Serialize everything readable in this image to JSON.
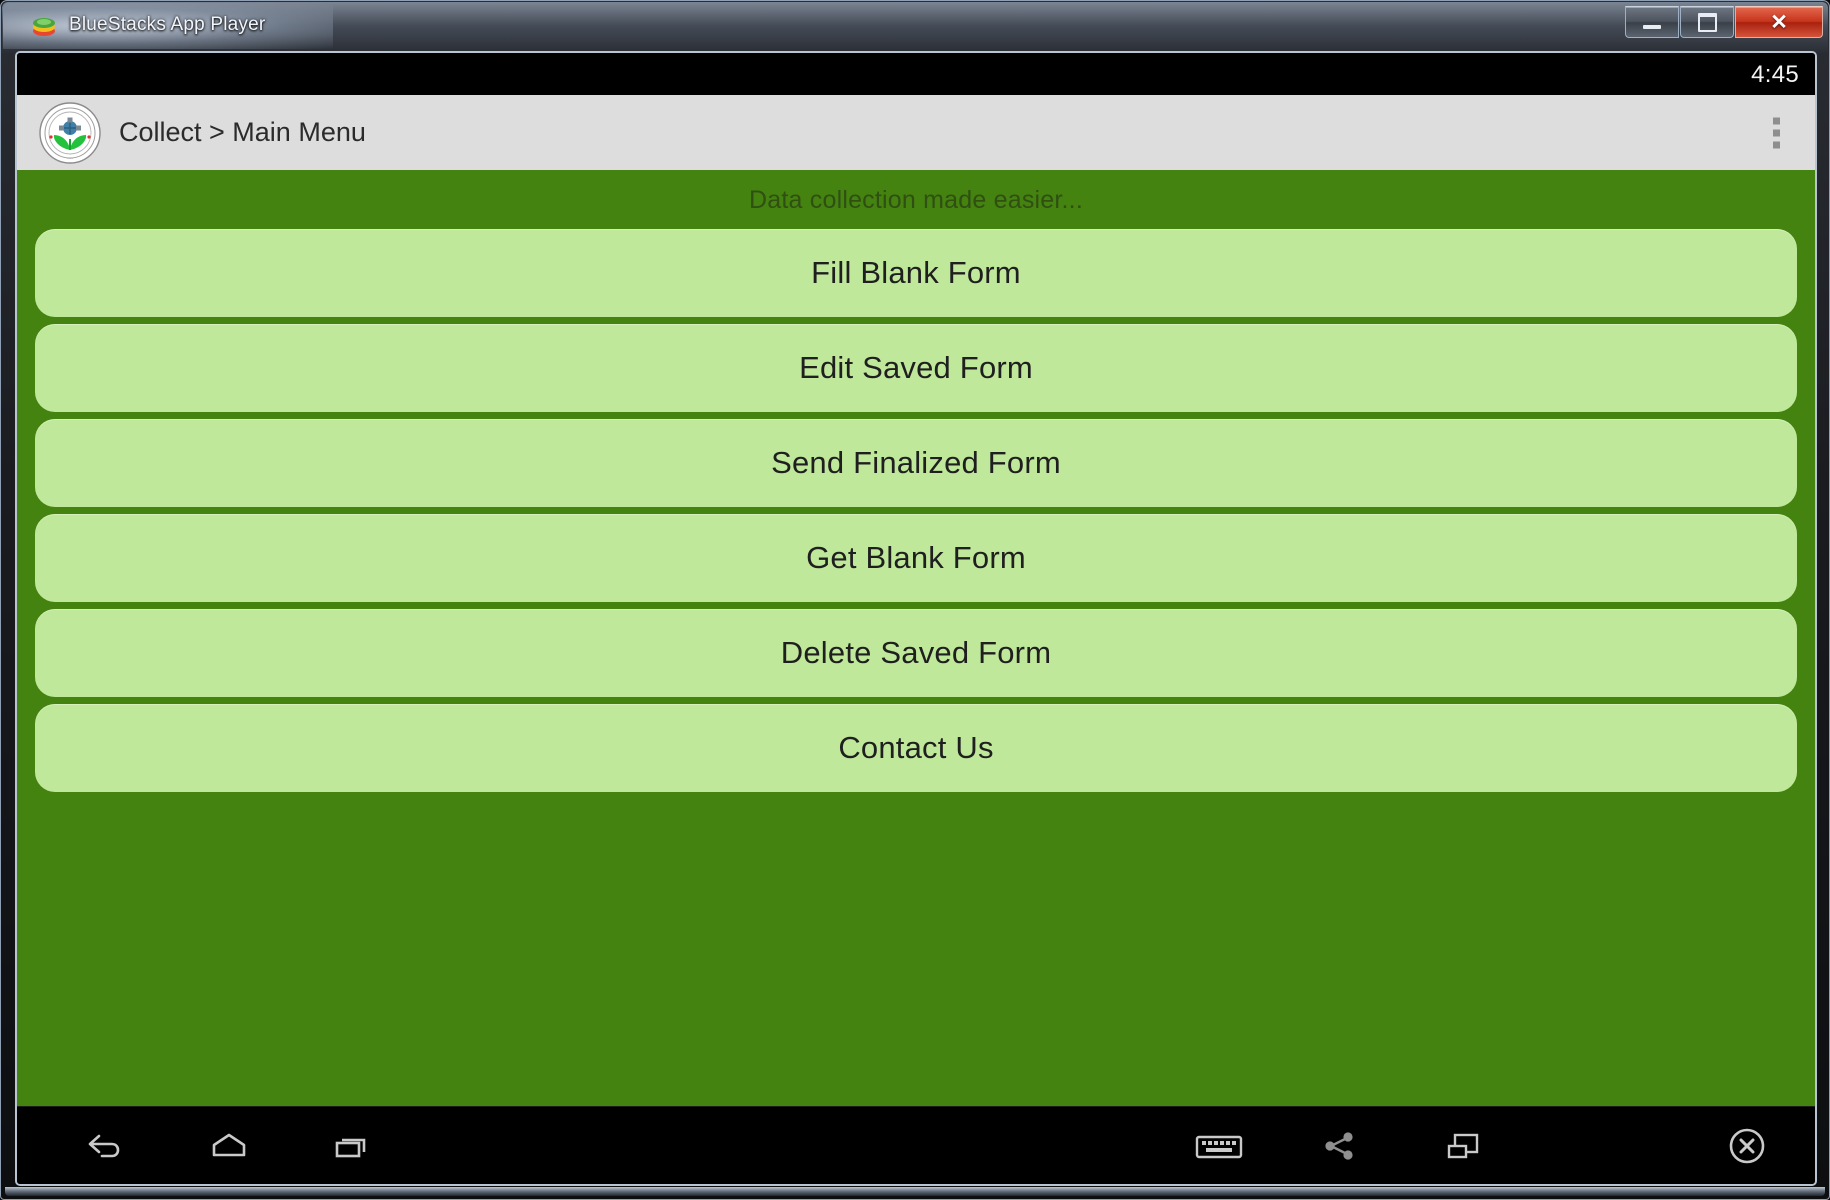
{
  "window": {
    "title": "BlueStacks App Player",
    "app_icon": "bluestacks-stack-icon",
    "controls": {
      "minimize": "minimize-icon",
      "maximize": "maximize-icon",
      "close": "✕"
    }
  },
  "status_bar": {
    "clock": "4:45"
  },
  "action_bar": {
    "logo": "collect-emblem-logo",
    "title": "Collect > Main Menu",
    "overflow": "overflow-menu-icon"
  },
  "content": {
    "tagline": "Data collection made easier...",
    "background_color": "#44830f",
    "button_color": "#bfe89a",
    "buttons": [
      {
        "label": "Fill Blank Form"
      },
      {
        "label": "Edit Saved Form"
      },
      {
        "label": "Send Finalized Form"
      },
      {
        "label": "Get Blank Form"
      },
      {
        "label": "Delete Saved Form"
      },
      {
        "label": "Contact Us"
      }
    ]
  },
  "nav_bar": {
    "back": "back-arrow-icon",
    "home": "home-icon",
    "recents": "recent-apps-icon",
    "keyboard": "keyboard-icon",
    "share": "share-icon",
    "window": "window-resize-icon",
    "close": "close-circle-icon"
  }
}
